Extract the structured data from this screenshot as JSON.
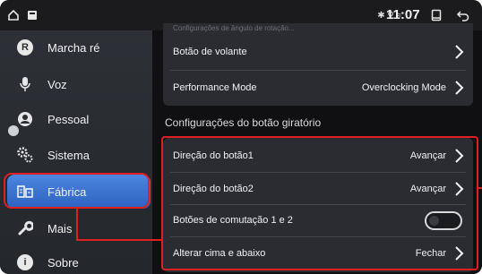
{
  "statusbar": {
    "time": "11:07",
    "status_icons": "✱ ⚲ ≈"
  },
  "sidebar": {
    "items": [
      {
        "label": "Marcha ré",
        "icon": "reverse-gear-icon"
      },
      {
        "label": "Voz",
        "icon": "microphone-icon"
      },
      {
        "label": "Pessoal",
        "icon": "person-icon"
      },
      {
        "label": "Sistema",
        "icon": "gears-icon"
      },
      {
        "label": "Fábrica",
        "icon": "factory-icon",
        "active": true
      },
      {
        "label": "Mais",
        "icon": "wrench-icon"
      },
      {
        "label": "Sobre",
        "icon": "info-icon"
      }
    ]
  },
  "main": {
    "top_card": {
      "faded_text": "Configurações de ângulo de rotação...",
      "rows": [
        {
          "label": "Botão de volante",
          "value": ""
        },
        {
          "label": "Performance Mode",
          "value": "Overclocking Mode"
        }
      ]
    },
    "section_title": "Configurações do botão giratório",
    "rotary_card": {
      "rows": [
        {
          "label": "Direção do botão1",
          "value": "Avançar"
        },
        {
          "label": "Direção do botão2",
          "value": "Avançar"
        },
        {
          "label": "Botões de comutação 1 e 2",
          "value": "",
          "toggle": false
        },
        {
          "label": "Alterar cima e abaixo",
          "value": "Fechar"
        }
      ]
    }
  },
  "colors": {
    "accent": "#3a74d4",
    "annotation": "#e02020",
    "card_bg": "#2a2c31"
  }
}
